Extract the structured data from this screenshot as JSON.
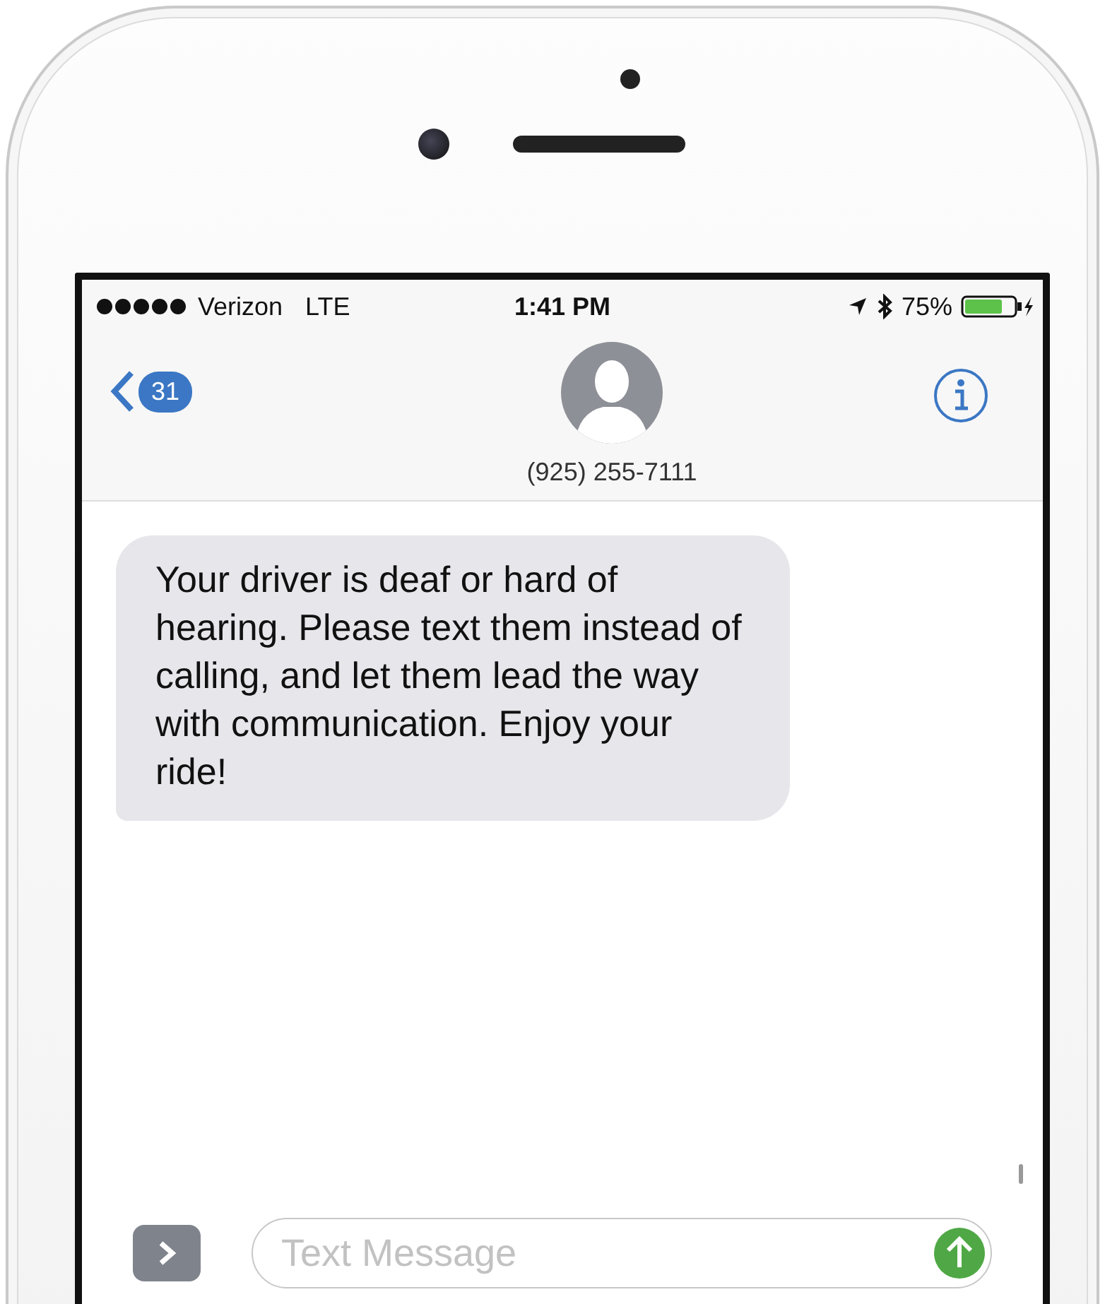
{
  "status_bar": {
    "carrier": "Verizon",
    "network": "LTE",
    "time": "1:41 PM",
    "battery": "75%"
  },
  "nav": {
    "back_count": "31",
    "contact": "(925) 255-7111"
  },
  "messages": [
    {
      "kind": "received",
      "text": "Your driver is deaf or hard of hearing. Please text them instead of calling, and let them lead the way with communication. Enjoy your ride!"
    }
  ],
  "composer": {
    "placeholder": "Text Message"
  }
}
